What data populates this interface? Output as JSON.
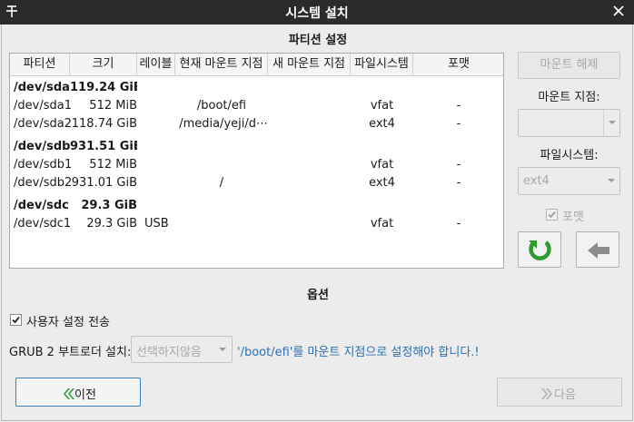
{
  "window": {
    "title": "시스템 설치"
  },
  "partition_section": {
    "title": "파티션 설정"
  },
  "table": {
    "headers": [
      "파티션",
      "크기",
      "레이블",
      "현재 마운트 지점",
      "새 마운트 지점",
      "파일시스템",
      "포맷"
    ],
    "rows": [
      {
        "partition": "/dev/sda",
        "size": "119.24 GiB",
        "label": "",
        "current_mount": "",
        "new_mount": "",
        "filesystem": "",
        "format": ""
      },
      {
        "partition": "/dev/sda1",
        "size": "512 MiB",
        "label": "",
        "current_mount": "/boot/efi",
        "new_mount": "",
        "filesystem": "vfat",
        "format": "-"
      },
      {
        "partition": "/dev/sda2",
        "size": "118.74 GiB",
        "label": "",
        "current_mount": "/media/yeji/d⋯",
        "new_mount": "",
        "filesystem": "ext4",
        "format": "-"
      },
      {
        "partition": "/dev/sdb",
        "size": "931.51 GiB",
        "label": "",
        "current_mount": "",
        "new_mount": "",
        "filesystem": "",
        "format": ""
      },
      {
        "partition": "/dev/sdb1",
        "size": "512 MiB",
        "label": "",
        "current_mount": "",
        "new_mount": "",
        "filesystem": "vfat",
        "format": "-"
      },
      {
        "partition": "/dev/sdb2",
        "size": "931.01 GiB",
        "label": "",
        "current_mount": "/",
        "new_mount": "",
        "filesystem": "ext4",
        "format": "-"
      },
      {
        "partition": "/dev/sdc",
        "size": "29.3 GiB",
        "label": "",
        "current_mount": "",
        "new_mount": "",
        "filesystem": "",
        "format": ""
      },
      {
        "partition": "/dev/sdc1",
        "size": "29.3 GiB",
        "label": "USB",
        "current_mount": "",
        "new_mount": "",
        "filesystem": "vfat",
        "format": "-"
      }
    ]
  },
  "side_panel": {
    "unmount_button": "마운트 해제",
    "mount_point_label": "마운트 지점:",
    "mount_point_value": "",
    "filesystem_label": "파일시스템:",
    "filesystem_value": "ext4",
    "format_label": "포맷",
    "format_checked": true
  },
  "options": {
    "title": "옵션",
    "transfer_user_settings_label": "사용자 설정 전송",
    "transfer_user_settings_checked": true,
    "grub_label": "GRUB 2 부트로더 설치:",
    "grub_select_value": "선택하지않음",
    "grub_hint": "'/boot/efi'를 마운트 지점으로 설정해야 합니다.!"
  },
  "nav": {
    "back_label": "이전",
    "next_label": "다음"
  },
  "colors": {
    "titlebar": "#2b2b2b",
    "accent_green": "#2f9a2f",
    "hint_blue": "#2a6fb5",
    "focus_border": "#3c7fc1"
  }
}
